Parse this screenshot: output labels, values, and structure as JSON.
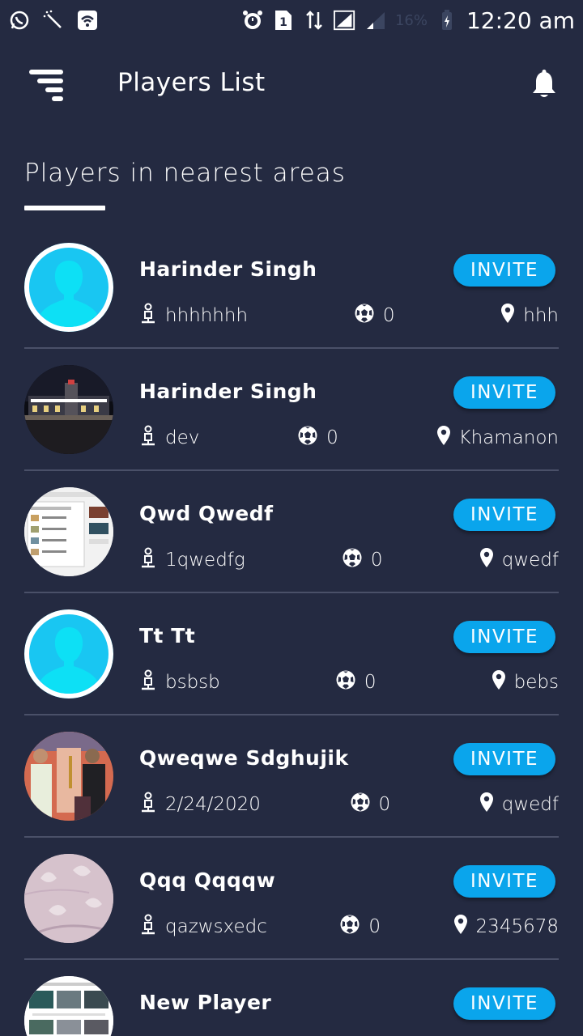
{
  "status_bar": {
    "battery": "16%",
    "time": "12:20 am"
  },
  "app_bar": {
    "title": "Players List",
    "menu_icon": "menu-icon",
    "notification_icon": "bell-icon"
  },
  "section": {
    "title": "Players in nearest areas"
  },
  "colors": {
    "background": "#242a41",
    "accent": "#0aa5ec",
    "divider": "#4a5068"
  },
  "invite_label": "INVITE",
  "players": [
    {
      "name": "Harinder Singh",
      "username": "hhhhhhh",
      "games": "0",
      "location": "hhh",
      "avatar": "default-avatar"
    },
    {
      "name": "Harinder Singh",
      "username": "dev",
      "games": "0",
      "location": "Khamanon",
      "avatar": "night-building-photo"
    },
    {
      "name": "Qwd Qwedf",
      "username": "1qwedfg",
      "games": "0",
      "location": "qwedf",
      "avatar": "screenshot-photo"
    },
    {
      "name": "Tt Tt",
      "username": "bsbsb",
      "games": "0",
      "location": "bebs",
      "avatar": "default-avatar"
    },
    {
      "name": "Qweqwe Sdghujik",
      "username": "2/24/2020",
      "games": "0",
      "location": "qwedf",
      "avatar": "people-photo"
    },
    {
      "name": "Qqq Qqqqw",
      "username": "qazwsxedc",
      "games": "0",
      "location": "2345678",
      "avatar": "fabric-photo"
    },
    {
      "name": "New Player",
      "username": "",
      "games": "",
      "location": "",
      "avatar": "website-photo"
    }
  ]
}
